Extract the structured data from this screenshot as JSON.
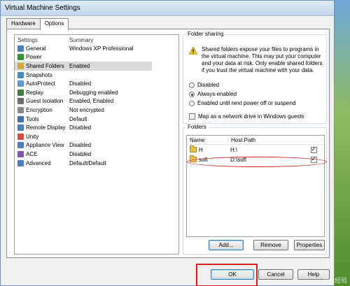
{
  "window": {
    "title": "Virtual Machine Settings"
  },
  "tabs": [
    {
      "label": "Hardware"
    },
    {
      "label": "Options"
    }
  ],
  "settings_list": {
    "headers": {
      "settings": "Settings",
      "summary": "Summary"
    },
    "rows": [
      {
        "label": "General",
        "summary": "Windows XP Professional",
        "icon": "general-icon",
        "color": "#4a7dc4"
      },
      {
        "label": "Power",
        "summary": "",
        "icon": "power-icon",
        "color": "#2e9a2e"
      },
      {
        "label": "Shared Folders",
        "summary": "Enabled",
        "icon": "shared-folders-icon",
        "color": "#d7a930",
        "selected": true
      },
      {
        "label": "Snapshots",
        "summary": "",
        "icon": "snapshots-icon",
        "color": "#3a8ec2"
      },
      {
        "label": "AutoProtect",
        "summary": "Disabled",
        "icon": "autoprotect-icon",
        "color": "#5a9bd6"
      },
      {
        "label": "Replay",
        "summary": "Debugging enabled",
        "icon": "replay-icon",
        "color": "#3c7f3c"
      },
      {
        "label": "Guest Isolation",
        "summary": "Enabled, Enabled",
        "icon": "guest-isolation-icon",
        "color": "#6e6e6e"
      },
      {
        "label": "Encryption",
        "summary": "Not encrypted",
        "icon": "encryption-icon",
        "color": "#888888"
      },
      {
        "label": "Tools",
        "summary": "Default",
        "icon": "tools-icon",
        "color": "#3f6fb5"
      },
      {
        "label": "Remote Display",
        "summary": "Disabled",
        "icon": "remote-display-icon",
        "color": "#4a7dc4"
      },
      {
        "label": "Unity",
        "summary": "",
        "icon": "unity-icon",
        "color": "#d24d3c"
      },
      {
        "label": "Appliance View",
        "summary": "Disabled",
        "icon": "appliance-view-icon",
        "color": "#4a7dc4"
      },
      {
        "label": "ACE",
        "summary": "Disabled",
        "icon": "ace-icon",
        "color": "#7b58b0"
      },
      {
        "label": "Advanced",
        "summary": "Default/Default",
        "icon": "advanced-icon",
        "color": "#4a7dc4"
      }
    ]
  },
  "folder_sharing": {
    "title": "Folder sharing",
    "warning": "Shared folders expose your files to programs in the virtual machine. This may put your computer and your data at risk. Only enable shared folders if you trust the virtual machine with your data.",
    "options": [
      {
        "label": "Disabled",
        "selected": false
      },
      {
        "label": "Always enabled",
        "selected": true
      },
      {
        "label": "Enabled until next power off or suspend",
        "selected": false
      }
    ],
    "map_drive_label": "Map as a network drive in Windows guests",
    "map_drive_checked": false
  },
  "folders": {
    "title": "Folders",
    "headers": {
      "name": "Name",
      "host_path": "Host Path"
    },
    "rows": [
      {
        "name": "H",
        "host_path": "H:\\",
        "checked": true
      },
      {
        "name": "soft",
        "host_path": "D:\\soft",
        "checked": true
      }
    ],
    "buttons": {
      "add": "Add...",
      "remove": "Remove",
      "properties": "Properties"
    }
  },
  "dialog_buttons": {
    "ok": "OK",
    "cancel": "Cancel",
    "help": "Help"
  },
  "watermark": "Bai 经验",
  "colors": {
    "highlight_red": "#d31f1f",
    "selection_gray": "#dadada"
  }
}
